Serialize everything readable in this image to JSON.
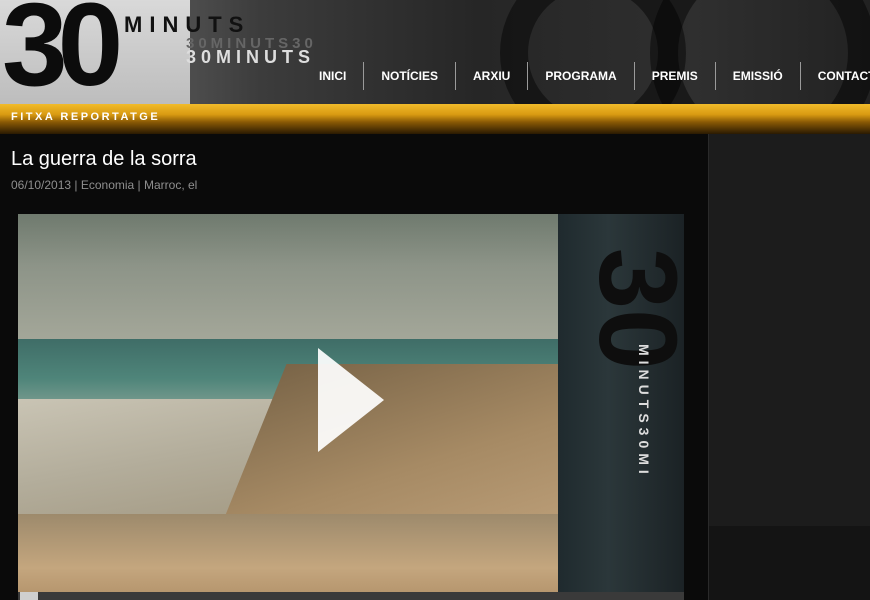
{
  "header": {
    "logo_number": "30",
    "logo_word_top": "MINUTS",
    "logo_word_ghost": "30MINUTS30",
    "logo_word_bottom": "30MINUTS"
  },
  "nav": {
    "items": [
      {
        "label": "INICI"
      },
      {
        "label": "NOTÍCIES"
      },
      {
        "label": "ARXIU"
      },
      {
        "label": "PROGRAMA"
      },
      {
        "label": "PREMIS"
      },
      {
        "label": "EMISSIÓ"
      },
      {
        "label": "CONTACTA"
      }
    ]
  },
  "section_bar": {
    "label": "FITXA REPORTATGE"
  },
  "article": {
    "title": "La guerra de la sorra",
    "meta": "06/10/2013 | Economia | Marroc, el"
  },
  "video": {
    "promo_number": "30",
    "promo_text": "MINUTS30MI",
    "progress_fraction": 0.0
  },
  "colors": {
    "accent_gold": "#e0a51c",
    "background": "#0a0a0a"
  }
}
